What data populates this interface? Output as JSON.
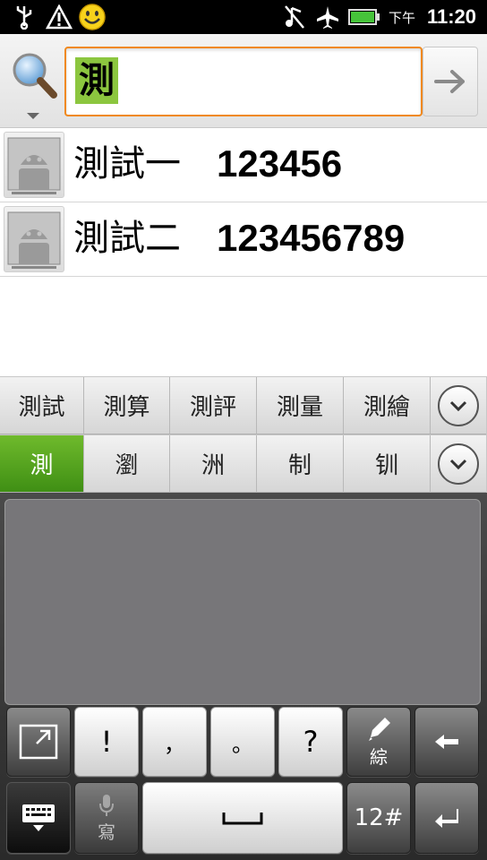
{
  "status_bar": {
    "icons_left": [
      "usb-icon",
      "warning-icon",
      "smiley-icon"
    ],
    "icons_right": [
      "mute-icon",
      "airplane-icon",
      "battery-icon"
    ],
    "ampm": "下午",
    "time": "11:20"
  },
  "search": {
    "query": "測",
    "go_icon": "arrow-right-icon",
    "accent": "#f0891d",
    "highlight": "#8cc63f"
  },
  "results": [
    {
      "name": "測試一",
      "number": "123456"
    },
    {
      "name": "測試二",
      "number": "123456789"
    }
  ],
  "candidates": {
    "row1": [
      "測試",
      "測算",
      "測評",
      "測量",
      "測繪"
    ],
    "row2": [
      "測",
      "瀏",
      "洲",
      "制",
      "钏"
    ],
    "selected": "測",
    "selected_color": "#4fa01f"
  },
  "keyboard": {
    "punct": [
      "!",
      "，",
      "。",
      "?"
    ],
    "pen_label": "綜",
    "voice_label": "寫",
    "space_label": "⎵",
    "numeric_label": "12#"
  }
}
